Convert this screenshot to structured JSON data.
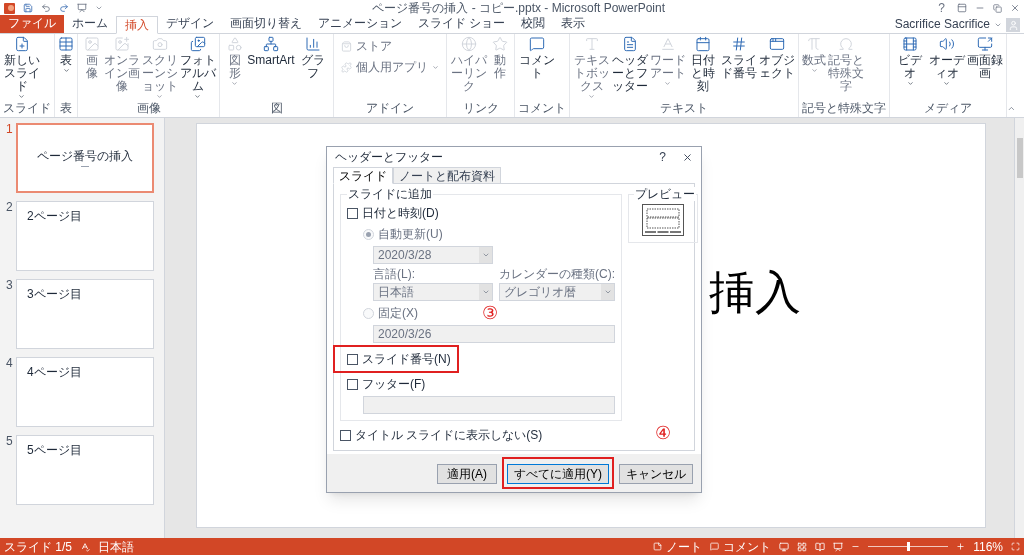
{
  "title_bar": {
    "title": "ページ番号の挿入 - コピー.pptx - Microsoft PowerPoint",
    "help": "?",
    "user": "Sacrifice Sacrifice"
  },
  "tabs": [
    {
      "label": "ファイル",
      "kind": "file",
      "selected": false
    },
    {
      "label": "ホーム",
      "kind": "tab",
      "selected": false
    },
    {
      "label": "挿入",
      "kind": "tab",
      "selected": true
    },
    {
      "label": "デザイン",
      "kind": "tab",
      "selected": false
    },
    {
      "label": "画面切り替え",
      "kind": "tab",
      "selected": false
    },
    {
      "label": "アニメーション",
      "kind": "tab",
      "selected": false
    },
    {
      "label": "スライド ショー",
      "kind": "tab",
      "selected": false
    },
    {
      "label": "校閲",
      "kind": "tab",
      "selected": false
    },
    {
      "label": "表示",
      "kind": "tab",
      "selected": false
    }
  ],
  "ribbon_groups": [
    {
      "label": "スライド",
      "buttons": [
        {
          "label": "新しいスライド",
          "kind": "large",
          "disabled": false,
          "dropdown": true
        }
      ]
    },
    {
      "label": "表",
      "buttons": [
        {
          "label": "表",
          "kind": "large",
          "disabled": false,
          "dropdown": true
        }
      ]
    },
    {
      "label": "画像",
      "buttons": [
        {
          "label": "画像",
          "kind": "large",
          "disabled": true,
          "dropdown": false
        },
        {
          "label": "オンライン画像",
          "kind": "large",
          "disabled": true,
          "dropdown": false
        },
        {
          "label": "スクリーンショット",
          "kind": "large",
          "disabled": true,
          "dropdown": true
        },
        {
          "label": "フォトアルバム",
          "kind": "large",
          "disabled": false,
          "dropdown": true
        }
      ]
    },
    {
      "label": "図",
      "buttons": [
        {
          "label": "図形",
          "kind": "large",
          "disabled": true,
          "dropdown": true
        },
        {
          "label": "SmartArt",
          "kind": "large",
          "disabled": false,
          "dropdown": false
        },
        {
          "label": "グラフ",
          "kind": "large",
          "disabled": false,
          "dropdown": false
        }
      ]
    },
    {
      "label": "アドイン",
      "buttons": [
        {
          "label": "ストア",
          "kind": "small",
          "disabled": true,
          "dropdown": false
        },
        {
          "label": "個人用アプリ",
          "kind": "small",
          "disabled": true,
          "dropdown": true
        }
      ]
    },
    {
      "label": "リンク",
      "buttons": [
        {
          "label": "ハイパーリンク",
          "kind": "large",
          "disabled": true,
          "dropdown": false
        },
        {
          "label": "動作",
          "kind": "large",
          "disabled": true,
          "dropdown": false
        }
      ]
    },
    {
      "label": "コメント",
      "buttons": [
        {
          "label": "コメント",
          "kind": "large",
          "disabled": false,
          "dropdown": false
        }
      ]
    },
    {
      "label": "テキスト",
      "buttons": [
        {
          "label": "テキストボックス",
          "kind": "large",
          "disabled": true,
          "dropdown": true
        },
        {
          "label": "ヘッダーとフッター",
          "kind": "large",
          "disabled": false,
          "dropdown": false
        },
        {
          "label": "ワードアート",
          "kind": "large",
          "disabled": true,
          "dropdown": true
        },
        {
          "label": "日付と時刻",
          "kind": "large",
          "disabled": false,
          "dropdown": false
        },
        {
          "label": "スライド番号",
          "kind": "large",
          "disabled": false,
          "dropdown": false
        },
        {
          "label": "オブジェクト",
          "kind": "large",
          "disabled": false,
          "dropdown": false
        }
      ]
    },
    {
      "label": "記号と特殊文字",
      "buttons": [
        {
          "label": "数式",
          "kind": "large",
          "disabled": true,
          "dropdown": true
        },
        {
          "label": "記号と特殊文字",
          "kind": "large",
          "disabled": true,
          "dropdown": false
        }
      ]
    },
    {
      "label": "メディア",
      "buttons": [
        {
          "label": "ビデオ",
          "kind": "large",
          "disabled": false,
          "dropdown": true
        },
        {
          "label": "オーディオ",
          "kind": "large",
          "disabled": false,
          "dropdown": true
        },
        {
          "label": "画面録画",
          "kind": "large",
          "disabled": false,
          "dropdown": false
        }
      ]
    }
  ],
  "slides": [
    {
      "number": "1",
      "title": "ページ番号の挿入",
      "kind": "title",
      "selected": true
    },
    {
      "number": "2",
      "title": "2ページ目",
      "kind": "content",
      "selected": false
    },
    {
      "number": "3",
      "title": "3ページ目",
      "kind": "content",
      "selected": false
    },
    {
      "number": "4",
      "title": "4ページ目",
      "kind": "content",
      "selected": false
    },
    {
      "number": "5",
      "title": "5ページ目",
      "kind": "content",
      "selected": false
    }
  ],
  "slide_visible_text": "挿入",
  "dialog": {
    "title": "ヘッダーとフッター",
    "help": "?",
    "tabs": [
      {
        "label": "スライド",
        "selected": true
      },
      {
        "label": "ノートと配布資料",
        "selected": false
      }
    ],
    "group_label": "スライドに追加",
    "date_time": {
      "label": "日付と時刻(D)",
      "checked": false
    },
    "auto_update": {
      "label": "自動更新(U)",
      "selected": true,
      "disabled": true,
      "value": "2020/3/28"
    },
    "language": {
      "label": "言語(L):",
      "value": "日本語",
      "disabled": true
    },
    "calendar": {
      "label": "カレンダーの種類(C):",
      "value": "グレゴリオ暦",
      "disabled": true
    },
    "fixed": {
      "label": "固定(X)",
      "selected": false,
      "disabled": true,
      "value": "2020/3/26"
    },
    "slide_number": {
      "label": "スライド番号(N)",
      "checked": false
    },
    "footer": {
      "label": "フッター(F)",
      "checked": false
    },
    "hide_on_title": {
      "label": "タイトル スライドに表示しない(S)",
      "checked": false
    },
    "preview_label": "プレビュー",
    "buttons": [
      {
        "label": "適用(A)",
        "default": false
      },
      {
        "label": "すべてに適用(Y)",
        "default": true
      },
      {
        "label": "キャンセル",
        "default": false
      }
    ]
  },
  "annotations": [
    {
      "text": "③"
    },
    {
      "text": "④"
    }
  ],
  "status_bar": {
    "slide": "スライド 1/5",
    "language": "日本語",
    "notes": "ノート",
    "comments": "コメント",
    "zoom": "116%",
    "zoom_slider": {
      "level": 0.5
    }
  }
}
